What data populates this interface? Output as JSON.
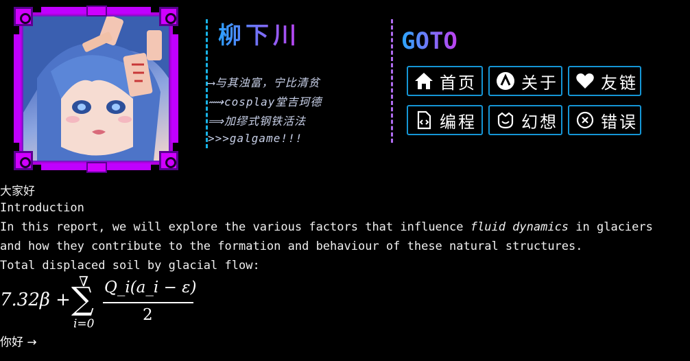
{
  "header": {
    "title": "柳下川",
    "mottos": [
      "⟶与其浊富，宁比清贫",
      "⟿cosplay堂吉珂德",
      "⟹加缪式钢铁活法",
      ">>>galgame!!!"
    ]
  },
  "nav": {
    "title": "GOTO",
    "items": [
      {
        "label": "首页",
        "icon": "home-icon"
      },
      {
        "label": "关于",
        "icon": "a-circle-icon"
      },
      {
        "label": "友链",
        "icon": "heart-icon"
      },
      {
        "label": "编程",
        "icon": "code-file-icon"
      },
      {
        "label": "幻想",
        "icon": "flower-smile-icon"
      },
      {
        "label": "错误",
        "icon": "x-circle-icon"
      }
    ]
  },
  "content": {
    "greeting": "大家好",
    "heading": "Introduction",
    "para1_pre": "In this report, we will explore the various factors that influence ",
    "para1_em": "fluid dynamics",
    "para1_post": " in glaciers",
    "para2": "and how they contribute to the formation and behaviour of these natural structures.",
    "formula_label": "Total displaced soil by glacial flow:",
    "formula": {
      "lead": "7.32β +",
      "sum_top": "∇",
      "sum_sign": "∑",
      "sum_bottom": "i=0",
      "numerator": "Q_i(a_i − ε)",
      "denominator": "2"
    },
    "link_text": "你好 →"
  },
  "colors": {
    "accent_cyan": "#1596d6",
    "accent_purple": "#b06cf0",
    "frame_magenta": "#d000ff"
  }
}
